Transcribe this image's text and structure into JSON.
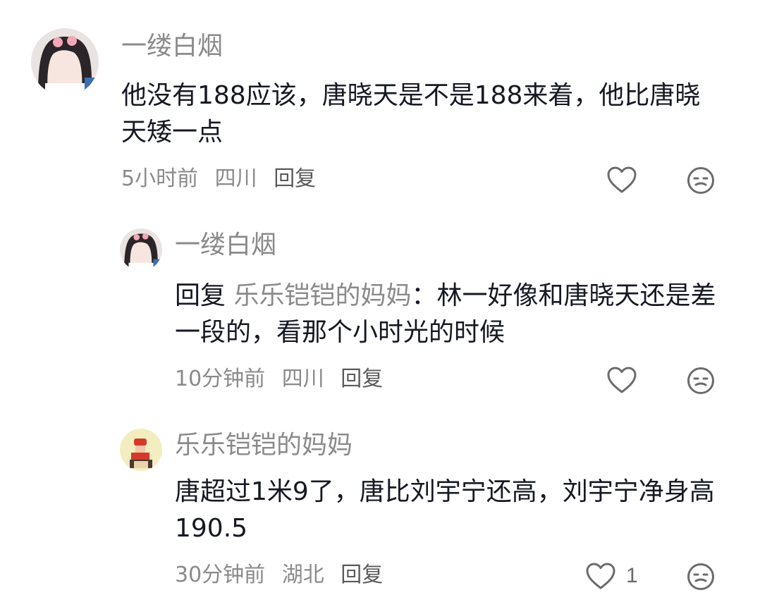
{
  "comments": [
    {
      "username": "一缕白烟",
      "text": "他没有188应该，唐晓天是不是188来着，他比唐晓天矮一点",
      "time": "5小时前",
      "location": "四川",
      "reply": "回复",
      "likes": ""
    },
    {
      "username": "一缕白烟",
      "reply_prefix": "回复",
      "mention": "乐乐铠铠的妈妈",
      "text": "：林一好像和唐晓天还是差一段的，看那个小时光的时候",
      "time": "10分钟前",
      "location": "四川",
      "reply": "回复",
      "likes": ""
    },
    {
      "username": "乐乐铠铠的妈妈",
      "text": "唐超过1米9了，唐比刘宇宁还高，刘宇宁净身高190.5",
      "time": "30分钟前",
      "location": "湖北",
      "reply": "回复",
      "likes": "1"
    }
  ],
  "icons": {
    "like": "heart-outline-icon",
    "dislike": "meh-face-icon"
  },
  "colors": {
    "text_primary": "#161823",
    "text_secondary": "#8a8a8a",
    "icon": "#6b6b6b"
  }
}
